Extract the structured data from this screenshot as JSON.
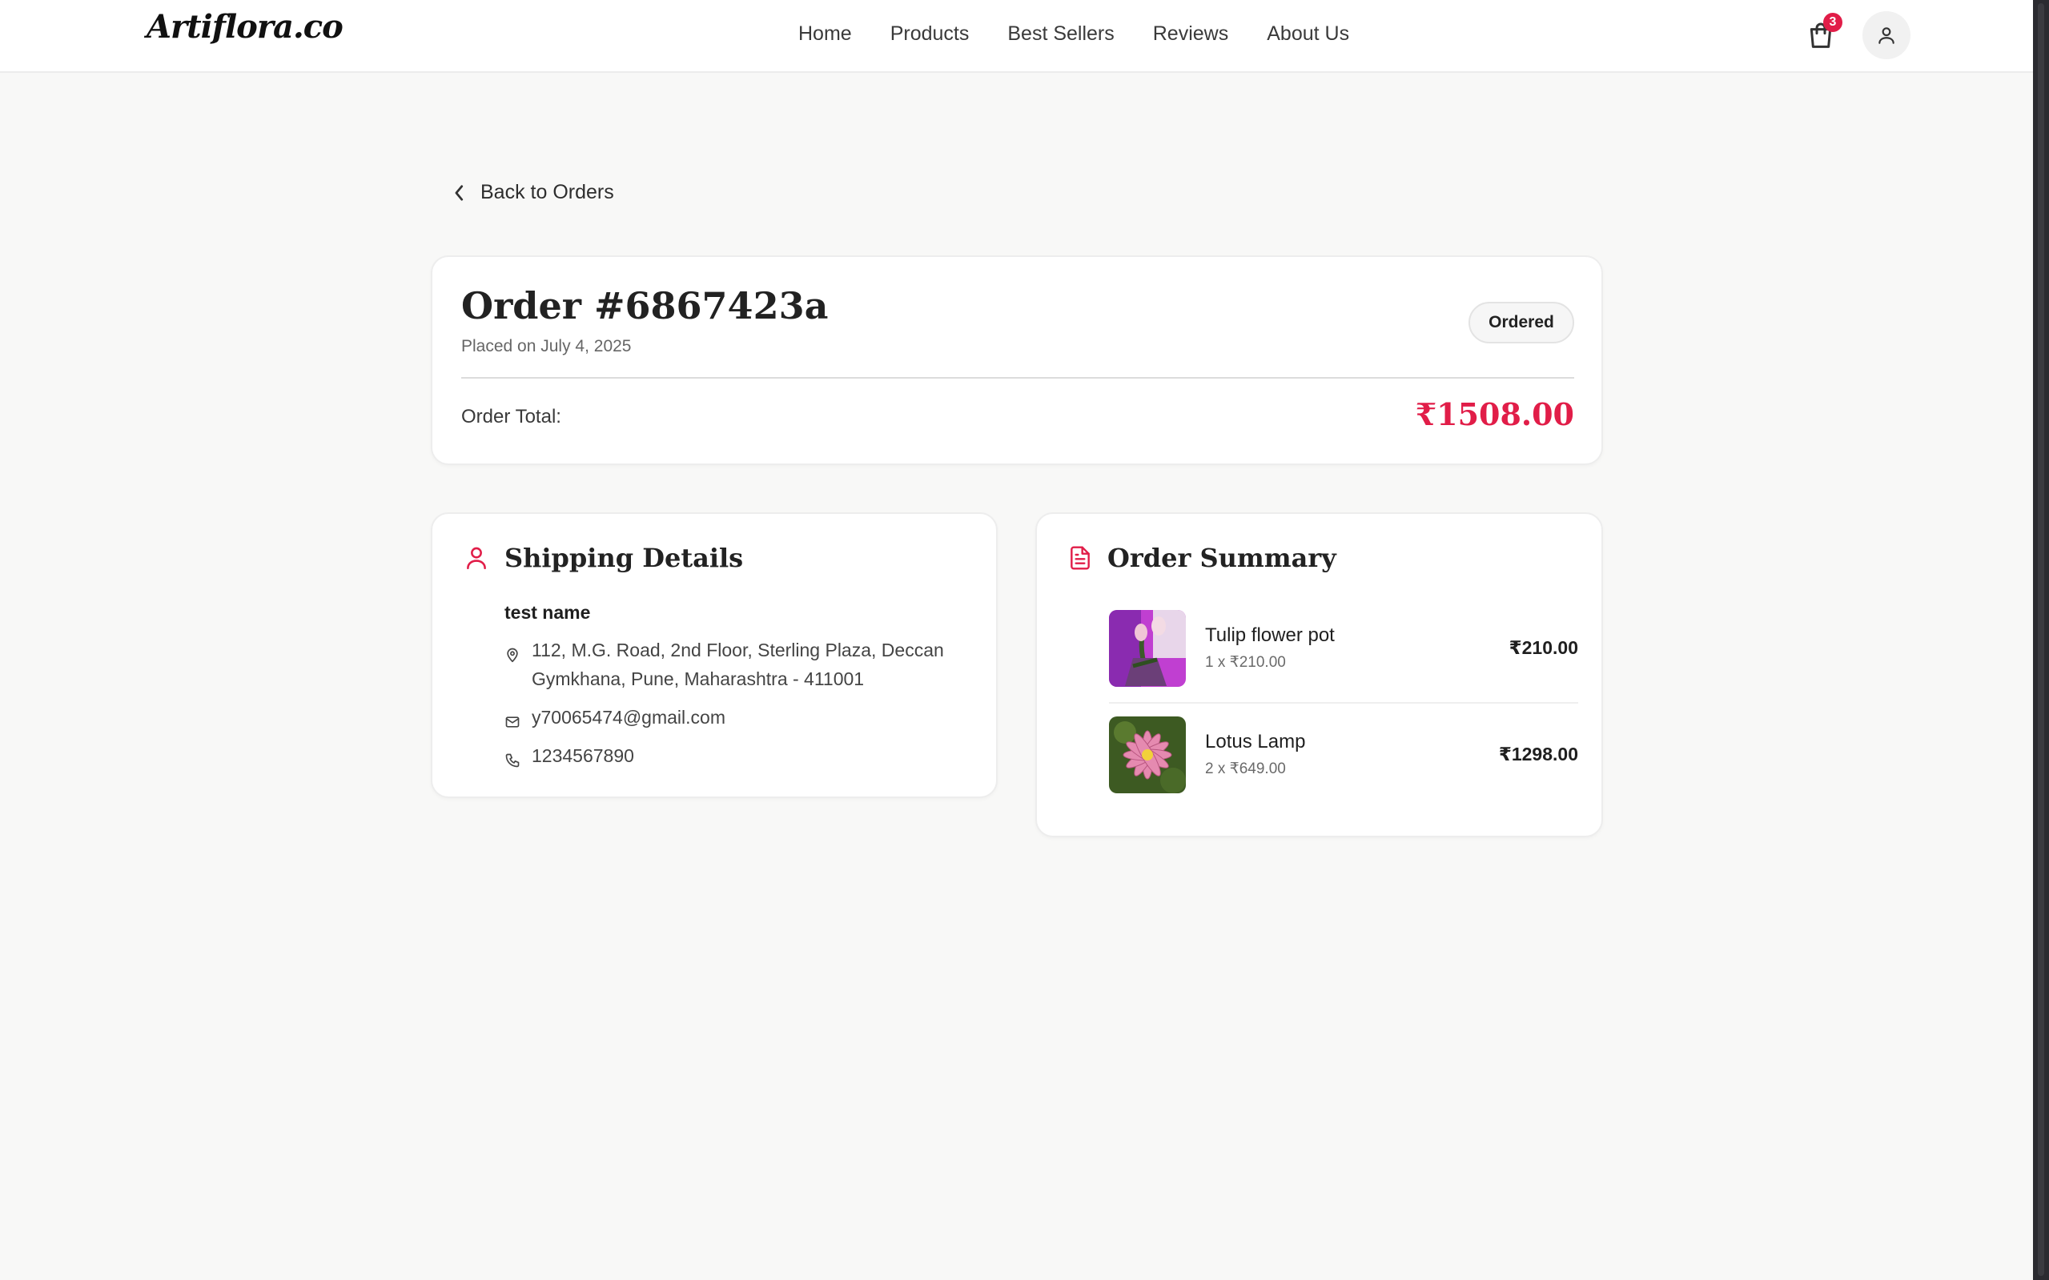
{
  "header": {
    "logo": "Artiflora.co",
    "nav": [
      "Home",
      "Products",
      "Best Sellers",
      "Reviews",
      "About Us"
    ],
    "cart_count": "3"
  },
  "back_label": "Back to Orders",
  "order": {
    "title": "Order #6867423a",
    "placed": "Placed on July 4, 2025",
    "status": "Ordered",
    "total_label": "Order Total:",
    "total_value": "₹1508.00"
  },
  "shipping": {
    "heading": "Shipping Details",
    "name": "test name",
    "address": "112, M.G. Road, 2nd Floor, Sterling Plaza, Deccan Gymkhana, Pune, Maharashtra - 411001",
    "email": "y70065474@gmail.com",
    "phone": "1234567890"
  },
  "summary": {
    "heading": "Order Summary",
    "items": [
      {
        "name": "Tulip flower pot",
        "qty": "1 x ₹210.00",
        "price": "₹210.00"
      },
      {
        "name": "Lotus Lamp",
        "qty": "2 x ₹649.00",
        "price": "₹1298.00"
      }
    ]
  },
  "colors": {
    "accent": "#e11d48",
    "background": "#f8f8f7",
    "card": "#ffffff"
  }
}
